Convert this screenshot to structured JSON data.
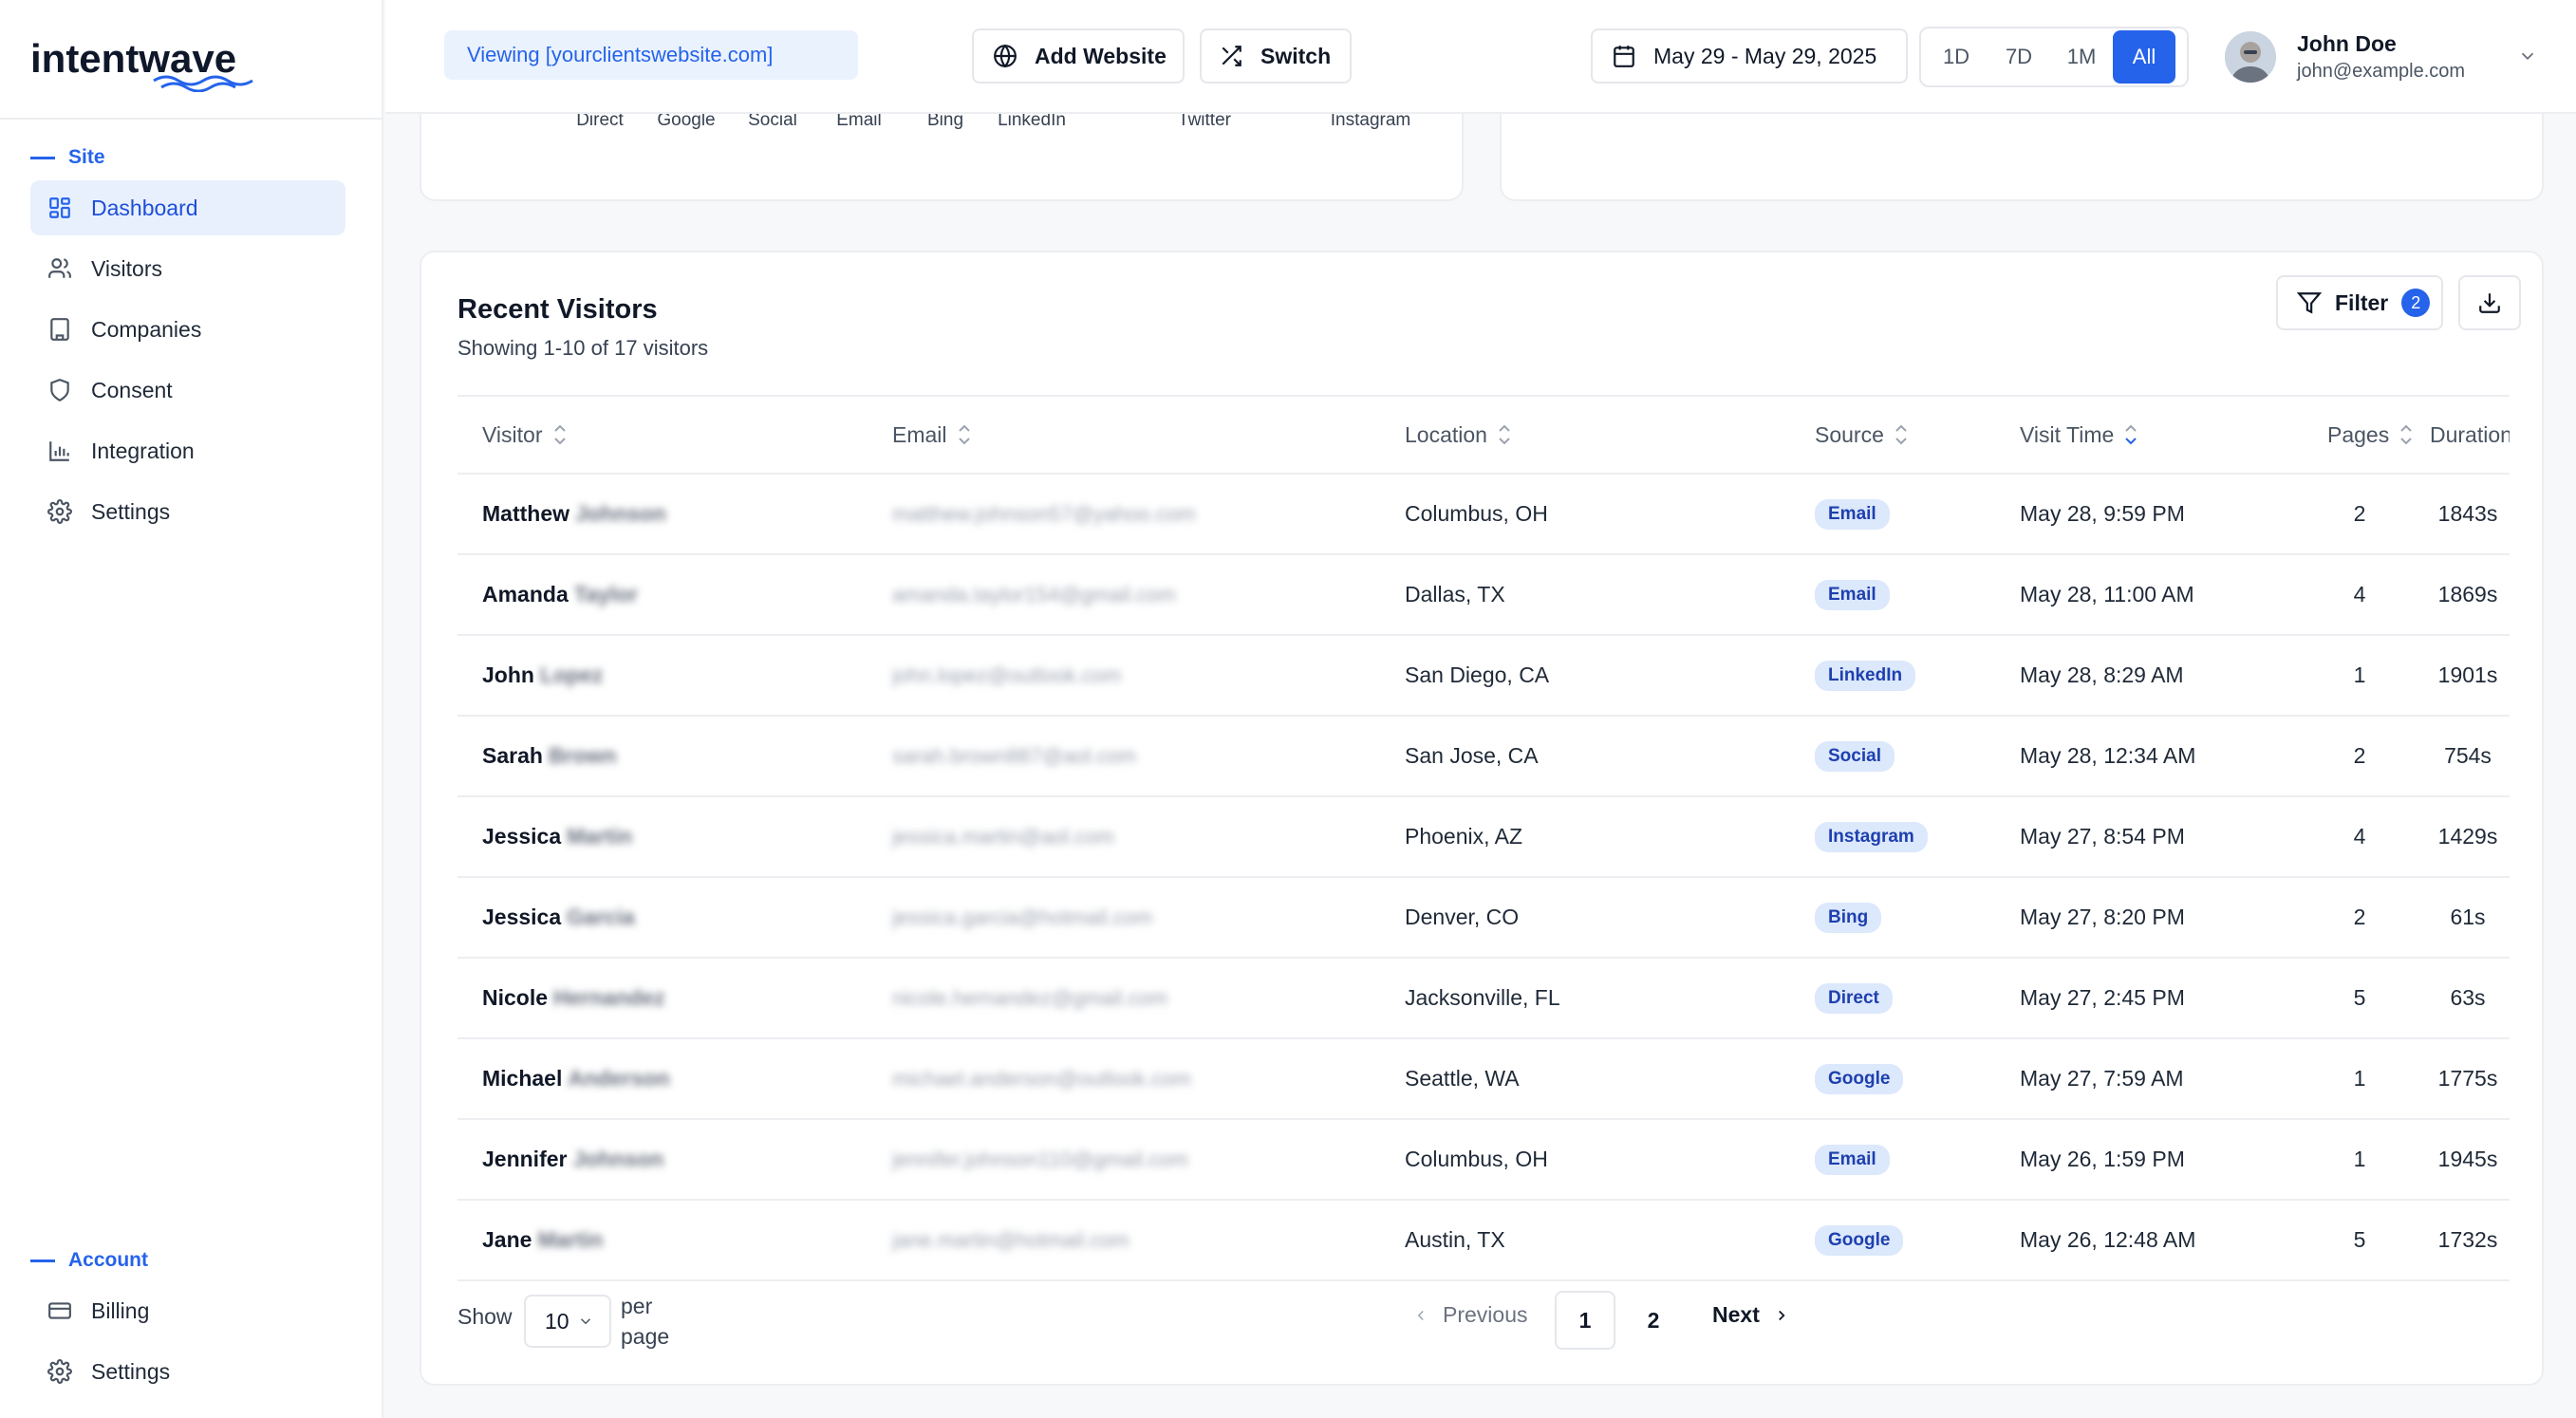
{
  "app": {
    "logo_text": "intentwave",
    "brand_color": "#2563eb"
  },
  "sidebar": {
    "site_section_label": "Site",
    "site_items": [
      {
        "label": "Dashboard",
        "icon": "dashboard-icon",
        "active": true
      },
      {
        "label": "Visitors",
        "icon": "users-icon",
        "active": false
      },
      {
        "label": "Companies",
        "icon": "building-icon",
        "active": false
      },
      {
        "label": "Consent",
        "icon": "shield-icon",
        "active": false
      },
      {
        "label": "Integration",
        "icon": "bar-chart-icon",
        "active": false
      },
      {
        "label": "Settings",
        "icon": "gear-icon",
        "active": false
      }
    ],
    "account_section_label": "Account",
    "account_items": [
      {
        "label": "Billing",
        "icon": "credit-card-icon"
      },
      {
        "label": "Settings",
        "icon": "gear-icon"
      }
    ]
  },
  "topbar": {
    "viewing_text": "Viewing [yourclientswebsite.com]",
    "add_website_label": "Add Website",
    "switch_label": "Switch",
    "date_range_label": "May 29 - May 29, 2025",
    "range_options": [
      "1D",
      "7D",
      "1M",
      "All"
    ],
    "range_selected": "All",
    "user": {
      "name": "John Doe",
      "email": "john@example.com"
    }
  },
  "chart_axis": {
    "labels": [
      "Direct",
      "Google",
      "Social",
      "Email",
      "Bing",
      "LinkedIn",
      "Twitter",
      "Instagram"
    ]
  },
  "recent_visitors": {
    "title": "Recent Visitors",
    "subtitle": "Showing 1-10 of 17 visitors",
    "filter_label": "Filter",
    "filter_count": "2",
    "columns": [
      "Visitor",
      "Email",
      "Location",
      "Source",
      "Visit Time",
      "Pages",
      "Duration"
    ],
    "rows": [
      {
        "first": "Matthew",
        "last": "Johnson",
        "email": "matthew.johnson57@yahoo.com",
        "location": "Columbus, OH",
        "source": "Email",
        "time": "May 28, 9:59 PM",
        "pages": "2",
        "duration": "1843s"
      },
      {
        "first": "Amanda",
        "last": "Taylor",
        "email": "amanda.taylor154@gmail.com",
        "location": "Dallas, TX",
        "source": "Email",
        "time": "May 28, 11:00 AM",
        "pages": "4",
        "duration": "1869s"
      },
      {
        "first": "John",
        "last": "Lopez",
        "email": "john.lopez@outlook.com",
        "location": "San Diego, CA",
        "source": "LinkedIn",
        "time": "May 28, 8:29 AM",
        "pages": "1",
        "duration": "1901s"
      },
      {
        "first": "Sarah",
        "last": "Brown",
        "email": "sarah.brown887@aol.com",
        "location": "San Jose, CA",
        "source": "Social",
        "time": "May 28, 12:34 AM",
        "pages": "2",
        "duration": "754s"
      },
      {
        "first": "Jessica",
        "last": "Martin",
        "email": "jessica.martin@aol.com",
        "location": "Phoenix, AZ",
        "source": "Instagram",
        "time": "May 27, 8:54 PM",
        "pages": "4",
        "duration": "1429s"
      },
      {
        "first": "Jessica",
        "last": "Garcia",
        "email": "jessica.garcia@hotmail.com",
        "location": "Denver, CO",
        "source": "Bing",
        "time": "May 27, 8:20 PM",
        "pages": "2",
        "duration": "61s"
      },
      {
        "first": "Nicole",
        "last": "Hernandez",
        "email": "nicole.hernandez@gmail.com",
        "location": "Jacksonville, FL",
        "source": "Direct",
        "time": "May 27, 2:45 PM",
        "pages": "5",
        "duration": "63s"
      },
      {
        "first": "Michael",
        "last": "Anderson",
        "email": "michael.anderson@outlook.com",
        "location": "Seattle, WA",
        "source": "Google",
        "time": "May 27, 7:59 AM",
        "pages": "1",
        "duration": "1775s"
      },
      {
        "first": "Jennifer",
        "last": "Johnson",
        "email": "jennifer.johnson110@gmail.com",
        "location": "Columbus, OH",
        "source": "Email",
        "time": "May 26, 1:59 PM",
        "pages": "1",
        "duration": "1945s"
      },
      {
        "first": "Jane",
        "last": "Martin",
        "email": "jane.martin@hotmail.com",
        "location": "Austin, TX",
        "source": "Google",
        "time": "May 26, 12:48 AM",
        "pages": "5",
        "duration": "1732s"
      }
    ]
  },
  "pagination": {
    "show_label": "Show",
    "page_size": "10",
    "per_page_label": "per page",
    "previous_label": "Previous",
    "pages": [
      "1",
      "2"
    ],
    "current_page": "1",
    "next_label": "Next"
  }
}
